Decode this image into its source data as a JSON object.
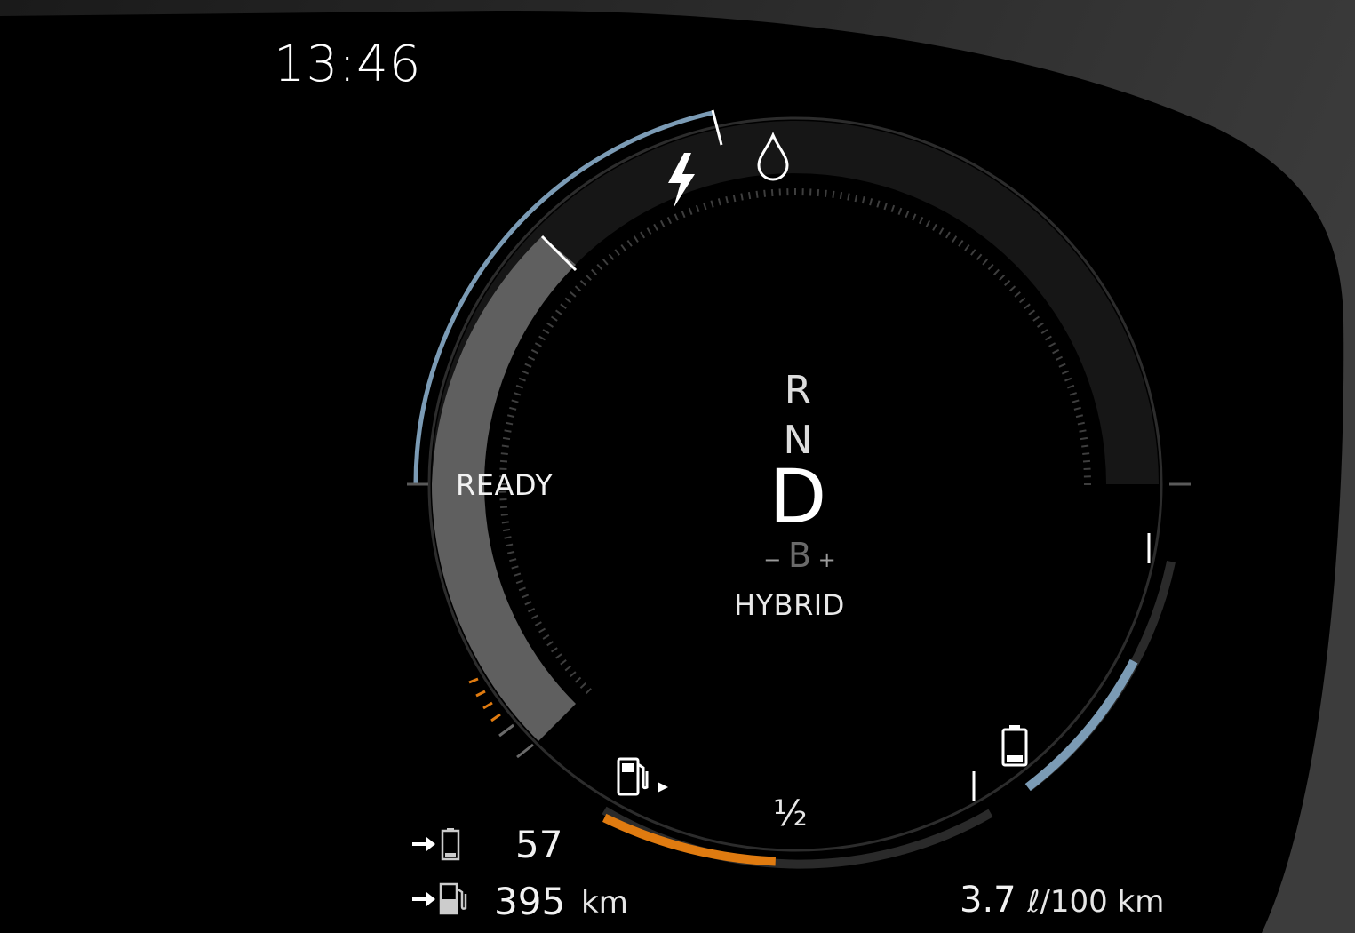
{
  "clock": "13:46",
  "status": "READY",
  "gears": {
    "r": "R",
    "n": "N",
    "d": "D",
    "b": "B",
    "minus": "−",
    "plus": "+"
  },
  "drive_mode": "HYBRID",
  "fuel_gauge": {
    "half_label": "½",
    "level_fraction": 0.45
  },
  "battery_gauge": {
    "level_fraction": 0.6
  },
  "power_gauge": {
    "level_fraction": 0.2
  },
  "range": {
    "electric_value": "57",
    "fuel_value": "395",
    "fuel_unit": "km"
  },
  "consumption": {
    "value": "3.7",
    "unit": "ℓ/100 km"
  },
  "icons": {
    "power": "lightning-icon",
    "charge": "drop-icon",
    "fuel": "fuel-pump-icon",
    "battery": "battery-icon",
    "range_battery": "arrow-battery-icon",
    "range_fuel": "arrow-fuel-pump-icon"
  },
  "colors": {
    "background": "#000000",
    "blue_arc": "#7b9bb5",
    "orange_arc": "#e07b10",
    "track": "#1e1e1e",
    "text": "#ffffff"
  }
}
